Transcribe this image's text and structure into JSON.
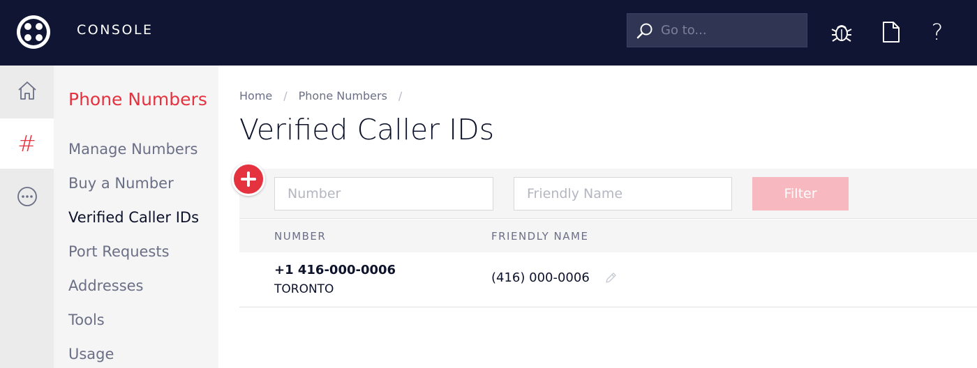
{
  "app": {
    "title": "CONSOLE",
    "search_placeholder": "Go to...",
    "icons": {
      "logo": "twilio-logo",
      "search": "search-icon",
      "debugger": "bug-icon",
      "docs": "document-icon",
      "help": "help-icon"
    },
    "help_label": "?"
  },
  "rail": {
    "items": [
      {
        "name": "home",
        "icon": "home-icon"
      },
      {
        "name": "phone-numbers",
        "icon": "hash-icon",
        "label": "#"
      },
      {
        "name": "more",
        "icon": "more-icon"
      }
    ]
  },
  "subnav": {
    "title": "Phone Numbers",
    "items": [
      {
        "label": "Manage Numbers"
      },
      {
        "label": "Buy a Number"
      },
      {
        "label": "Verified Caller IDs"
      },
      {
        "label": "Port Requests"
      },
      {
        "label": "Addresses"
      },
      {
        "label": "Tools"
      },
      {
        "label": "Usage"
      }
    ]
  },
  "breadcrumb": {
    "items": [
      "Home",
      "Phone Numbers"
    ],
    "separator": "/"
  },
  "page": {
    "title": "Verified Caller IDs"
  },
  "filters": {
    "number_placeholder": "Number",
    "friendly_placeholder": "Friendly Name",
    "filter_label": "Filter"
  },
  "table": {
    "headers": {
      "number": "NUMBER",
      "friendly": "FRIENDLY NAME"
    },
    "rows": [
      {
        "number": "+1 416-000-0006",
        "city": "TORONTO",
        "friendly": "(416) 000-0006"
      }
    ]
  },
  "colors": {
    "topbar": "#0f1532",
    "accent": "#e5323f",
    "filter_button": "#f7b9bf"
  }
}
